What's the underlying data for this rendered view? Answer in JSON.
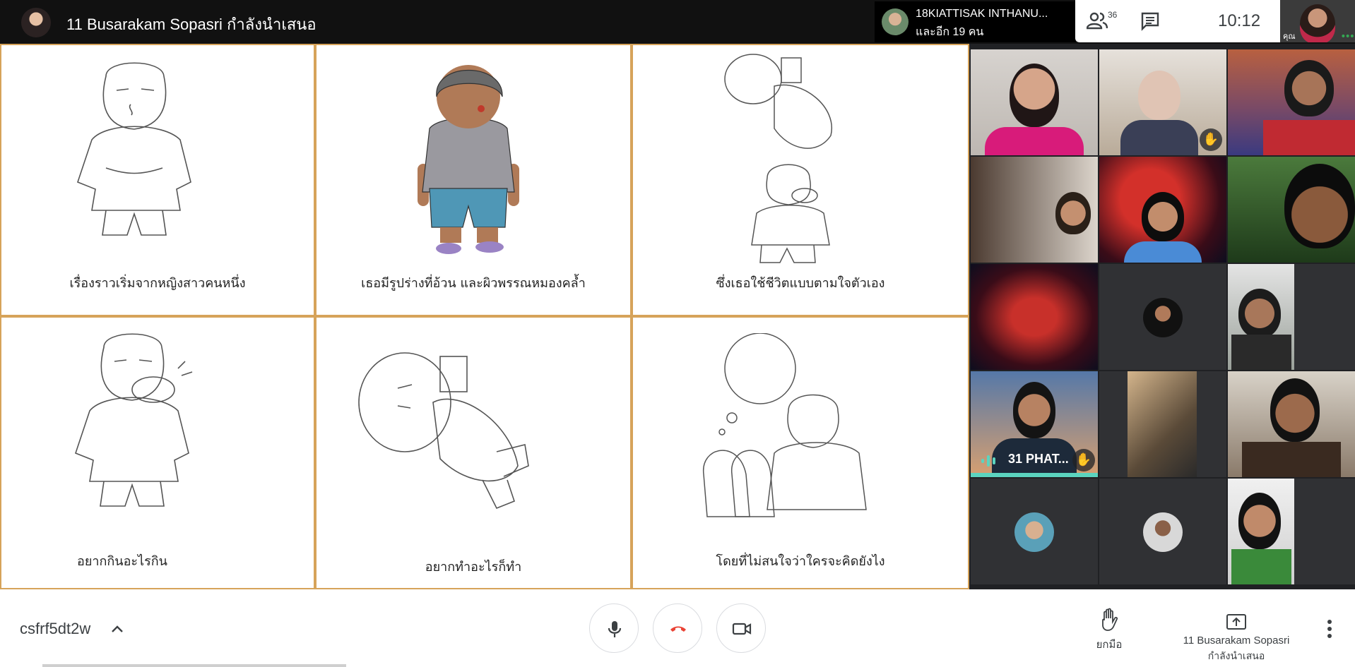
{
  "topbar": {
    "presenter_title": "11 Busarakam Sopasri กำลังนำเสนอ",
    "notification": {
      "line1": "18KIATTISAK INTHANU...",
      "line2": "และอีก 19 คน"
    },
    "participants_count": "36",
    "clock": "10:12",
    "self_label": "คุณ"
  },
  "slide": {
    "captions": [
      "เรื่องราวเริ่มจากหญิงสาวคนหนึ่ง",
      "เธอมีรูปร่างที่อ้วน และผิวพรรณหมองคล้ำ",
      "ซึ่งเธอใช้ชีวิตแบบตามใจตัวเอง",
      "อยากกินอะไรกิน",
      "อยากทำอะไรก็ทำ",
      "โดยที่ไม่สนใจว่าใครจะคิดยังไง"
    ]
  },
  "gallery": {
    "speaking_name": "31 PHAT..."
  },
  "bottombar": {
    "meeting_code": "csfrf5dt2w",
    "raise_hand_label": "ยกมือ",
    "present_line1": "11 Busarakam Sopasri",
    "present_line2": "กำลังนำเสนอ"
  },
  "colors": {
    "hangup": "#ea4335",
    "speaking": "#5bd4bf",
    "slide_border": "#d6a35a"
  }
}
